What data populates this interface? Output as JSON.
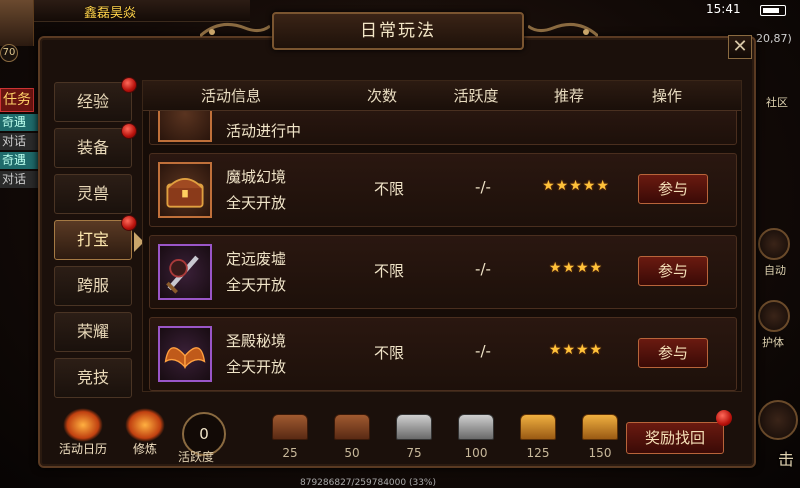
{
  "hud": {
    "player_name": "鑫磊昊焱",
    "level": "70",
    "time": "15:41",
    "coords": "20,87)",
    "left_tags": [
      "任务",
      "奇遇",
      "对话",
      "奇遇",
      "对话"
    ],
    "right_tags": [
      "社区",
      "自动",
      "护体",
      "击"
    ],
    "bottom_text": "879286827/259784000 (33%)"
  },
  "panel": {
    "title": "日常玩法",
    "close_label": "✕"
  },
  "tabs": [
    {
      "label": "经验",
      "badge": true
    },
    {
      "label": "装备",
      "badge": true
    },
    {
      "label": "灵兽",
      "badge": false
    },
    {
      "label": "打宝",
      "badge": true,
      "active": true
    },
    {
      "label": "跨服",
      "badge": false
    },
    {
      "label": "荣耀",
      "badge": false
    },
    {
      "label": "竞技",
      "badge": false
    }
  ],
  "table": {
    "headers": [
      "活动信息",
      "次数",
      "活跃度",
      "推荐",
      "操作"
    ],
    "partial_row": {
      "time": "活动进行中"
    },
    "rows": [
      {
        "name": "魔城幻境",
        "time": "全天开放",
        "times": "不限",
        "activity": "-/-",
        "stars": "★★★★★",
        "action": "参与"
      },
      {
        "name": "定远废墟",
        "time": "全天开放",
        "times": "不限",
        "activity": "-/-",
        "stars": "★★★★",
        "action": "参与"
      },
      {
        "name": "圣殿秘境",
        "time": "全天开放",
        "times": "不限",
        "activity": "-/-",
        "stars": "★★★★",
        "action": "参与"
      }
    ]
  },
  "footer": {
    "calendar_label": "活动日历",
    "train_label": "修炼",
    "active_score": "0",
    "active_label": "活跃度",
    "chests": [
      {
        "value": "25",
        "tier": "bronze"
      },
      {
        "value": "50",
        "tier": "bronze"
      },
      {
        "value": "75",
        "tier": "silver"
      },
      {
        "value": "100",
        "tier": "silver"
      },
      {
        "value": "125",
        "tier": "gold"
      },
      {
        "value": "150",
        "tier": "gold"
      }
    ],
    "recover_label": "奖励找回"
  },
  "colors": {
    "accent_gold": "#ffc23a",
    "panel_bg": "#1b100b",
    "button_red": "#6a1a10"
  }
}
